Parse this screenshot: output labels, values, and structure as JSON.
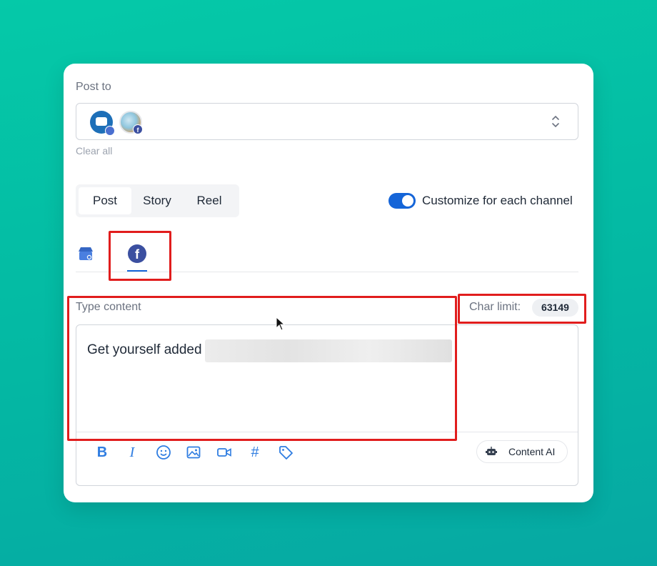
{
  "post_to": {
    "label": "Post to",
    "selected_channels": [
      {
        "icon": "google-business-icon",
        "badge_icon": "google-badge-icon"
      },
      {
        "icon": "facebook-page-avatar",
        "badge": "f"
      }
    ],
    "clear_all": "Clear all"
  },
  "post_type": {
    "tabs": [
      {
        "label": "Post",
        "active": true
      },
      {
        "label": "Story",
        "active": false
      },
      {
        "label": "Reel",
        "active": false
      }
    ]
  },
  "customize": {
    "label": "Customize for each channel",
    "enabled": true
  },
  "channel_tabs": [
    {
      "icon": "google-business-icon",
      "active": false
    },
    {
      "icon": "facebook-icon",
      "label": "f",
      "active": true
    }
  ],
  "editor": {
    "label": "Type content",
    "char_limit_label": "Char limit:",
    "char_limit_value": "63149",
    "text": "Get yourself added",
    "toolbar": [
      "bold",
      "italic",
      "emoji",
      "image",
      "video",
      "hashtag",
      "tag"
    ],
    "toolbar_glyphs": {
      "bold": "B",
      "italic": "I",
      "hashtag": "#"
    },
    "content_ai_label": "Content AI"
  },
  "colors": {
    "accent": "#1565d8",
    "highlight": "#e11d1d",
    "facebook": "#3b4fa0"
  }
}
